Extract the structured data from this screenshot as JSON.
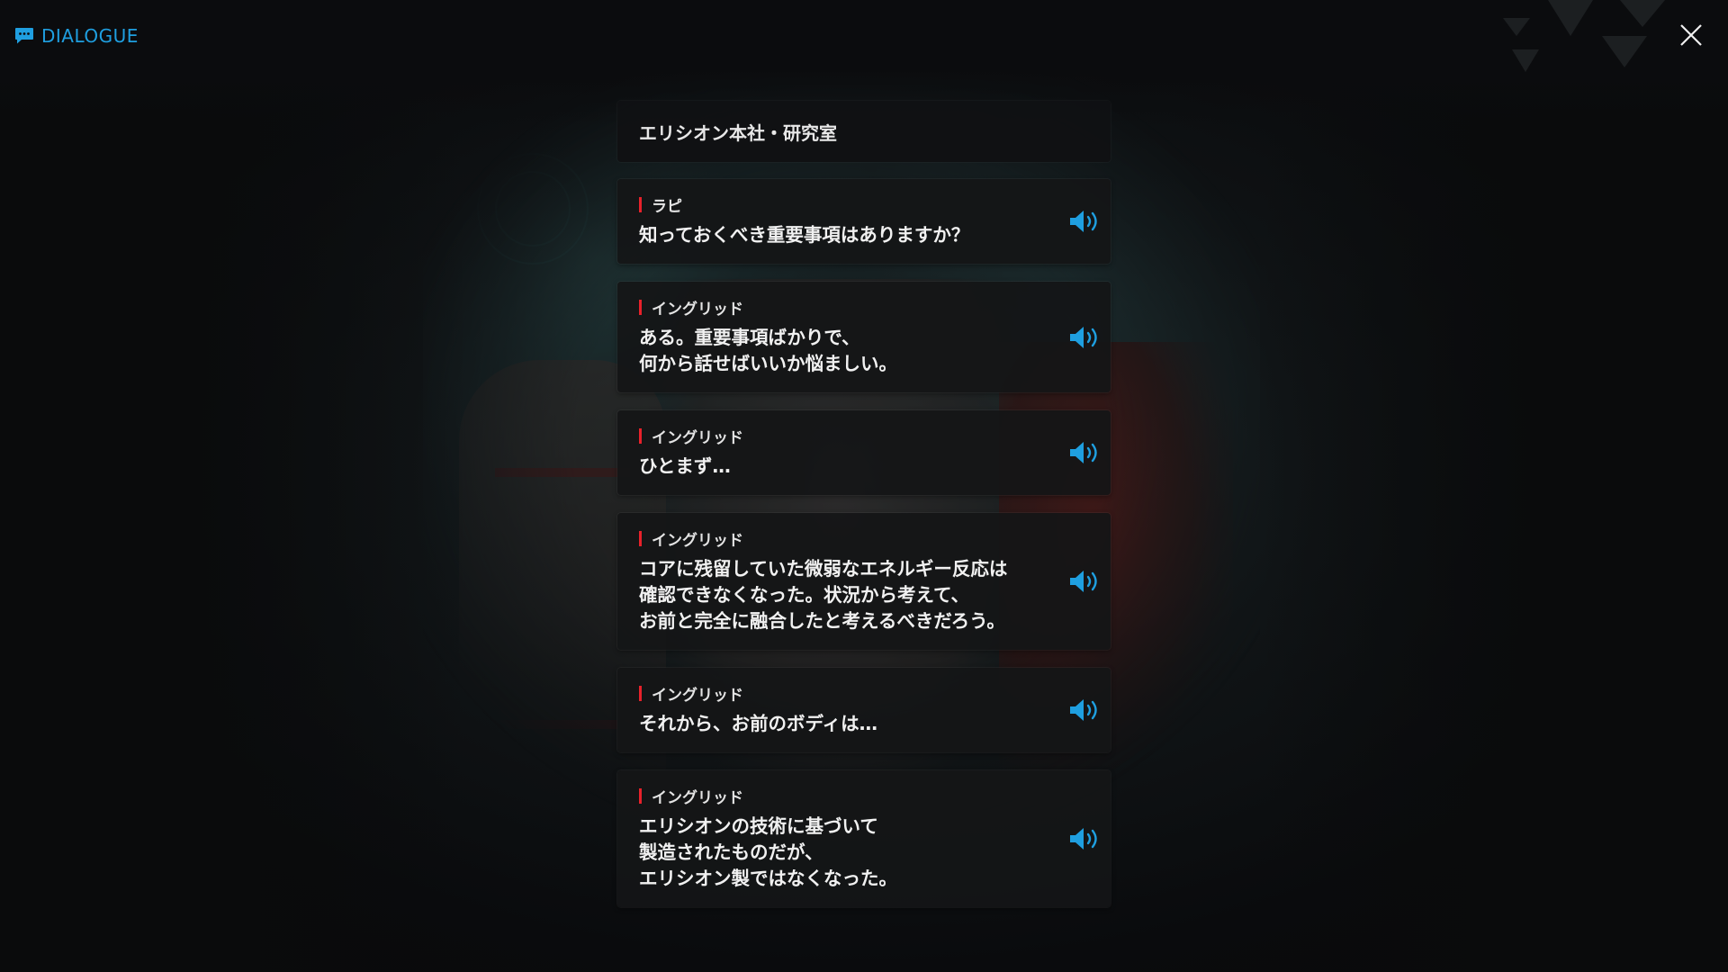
{
  "header": {
    "title": "DIALOGUE",
    "icon": "chat-bubble-icon",
    "accent_color": "#1f9fe0"
  },
  "close": {
    "icon": "close-icon"
  },
  "location": {
    "label": "エリシオン本社・研究室"
  },
  "entries": [
    {
      "speaker": "ラピ",
      "text": "知っておくべき重要事項はありますか？",
      "voice_icon": "speaker-icon"
    },
    {
      "speaker": "イングリッド",
      "text": "ある。重要事項ばかりで、\n何から話せばいいか悩ましい。",
      "voice_icon": "speaker-icon"
    },
    {
      "speaker": "イングリッド",
      "text": "ひとまず…",
      "voice_icon": "speaker-icon"
    },
    {
      "speaker": "イングリッド",
      "text": "コアに残留していた微弱なエネルギー反応は\n確認できなくなった。状況から考えて、\nお前と完全に融合したと考えるべきだろう。",
      "voice_icon": "speaker-icon"
    },
    {
      "speaker": "イングリッド",
      "text": "それから、お前のボディは…",
      "voice_icon": "speaker-icon"
    },
    {
      "speaker": "イングリッド",
      "text": "エリシオンの技術に基づいて\n製造されたものだが、\nエリシオン製ではなくなった。",
      "voice_icon": "speaker-icon"
    }
  ],
  "colors": {
    "speaker_marker": "#e8212a",
    "voice_icon": "#1f9fe0"
  }
}
